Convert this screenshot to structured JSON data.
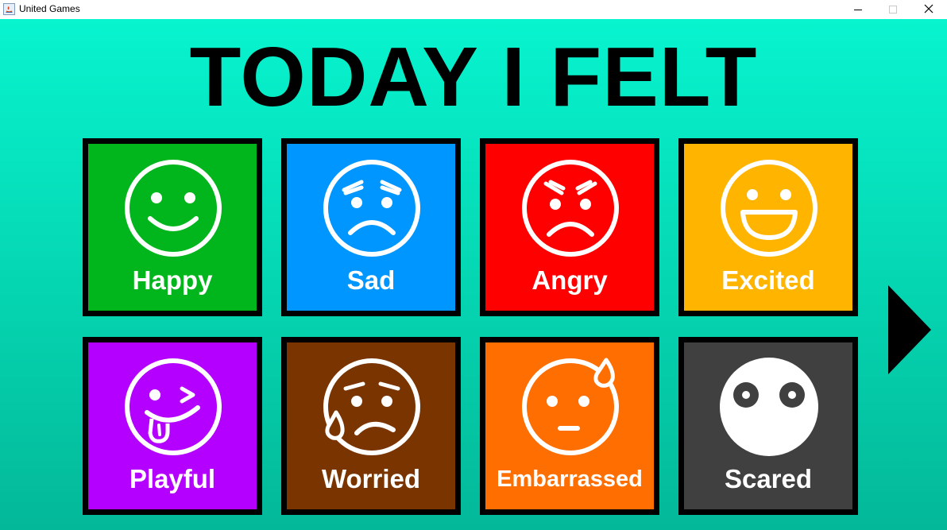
{
  "window": {
    "title": "United Games"
  },
  "page": {
    "heading": "TODAY I FELT"
  },
  "emotions": [
    {
      "label": "Happy",
      "color": "#00b61c",
      "icon": "happy-face-icon"
    },
    {
      "label": "Sad",
      "color": "#0096ff",
      "icon": "sad-face-icon"
    },
    {
      "label": "Angry",
      "color": "#ff0000",
      "icon": "angry-face-icon"
    },
    {
      "label": "Excited",
      "color": "#ffb400",
      "icon": "excited-face-icon"
    },
    {
      "label": "Playful",
      "color": "#b400ff",
      "icon": "playful-face-icon"
    },
    {
      "label": "Worried",
      "color": "#7a3400",
      "icon": "worried-face-icon"
    },
    {
      "label": "Embarrassed",
      "color": "#ff6e00",
      "icon": "embarrassed-face-icon"
    },
    {
      "label": "Scared",
      "color": "#404040",
      "icon": "scared-face-icon"
    }
  ],
  "navigation": {
    "next_icon": "play-arrow-icon"
  },
  "colors": {
    "background_top": "#07f4cf",
    "background_bottom": "#03b898",
    "tile_border": "#000000",
    "text": "#ffffff"
  }
}
